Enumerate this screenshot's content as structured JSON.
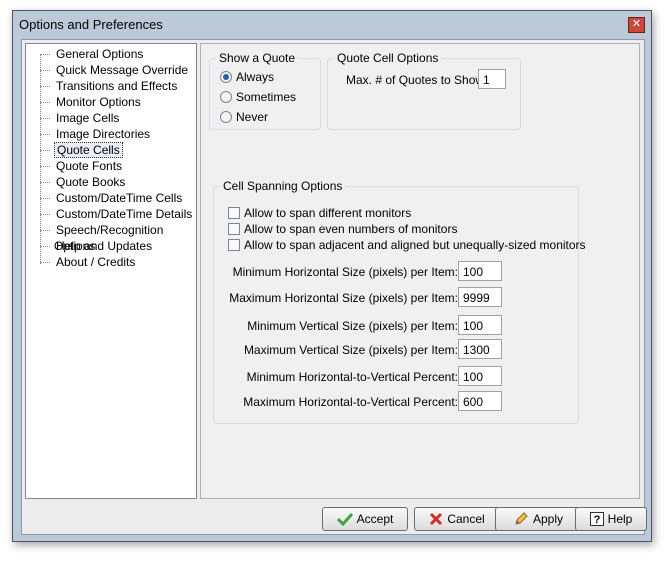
{
  "window": {
    "title": "Options and Preferences",
    "close_glyph": "✕"
  },
  "tree": {
    "items": [
      "General Options",
      "Quick Message Override",
      "Transitions and Effects",
      "Monitor Options",
      "Image Cells",
      "Image Directories",
      "Quote Cells",
      "Quote Fonts",
      "Quote Books",
      "Custom/DateTime Cells",
      "Custom/DateTime Details",
      "Speech/Recognition Options",
      "Help and Updates",
      "About / Credits"
    ],
    "selected": "Quote Cells"
  },
  "show_quote": {
    "title": "Show a Quote",
    "options": [
      "Always",
      "Sometimes",
      "Never"
    ],
    "selected": "Always"
  },
  "quote_cell": {
    "title": "Quote Cell Options",
    "max_label": "Max. # of Quotes to Show:",
    "max_value": "1"
  },
  "spanning": {
    "title": "Cell Spanning Options",
    "checks": [
      "Allow to span different monitors",
      "Allow to span even numbers of monitors",
      "Allow to span adjacent and aligned but unequally-sized monitors"
    ],
    "fields": [
      {
        "label": "Minimum Horizontal Size (pixels) per Item:",
        "value": "100"
      },
      {
        "label": "Maximum Horizontal Size (pixels) per Item:",
        "value": "9999"
      },
      {
        "label": "Minimum Vertical Size (pixels) per Item:",
        "value": "100"
      },
      {
        "label": "Maximum Vertical Size (pixels) per Item:",
        "value": "1300"
      },
      {
        "label": "Minimum Horizontal-to-Vertical  Percent:",
        "value": "100"
      },
      {
        "label": "Maximum Horizontal-to-Vertical  Percent:",
        "value": "600"
      }
    ]
  },
  "buttons": {
    "accept": "Accept",
    "cancel": "Cancel",
    "apply": "Apply",
    "help": "Help"
  },
  "icons": {
    "accept": "check-mark-icon",
    "cancel": "x-icon",
    "apply": "pencil-icon",
    "help": "question-mark-icon"
  },
  "colors": {
    "frame": "#bcc9d8",
    "dialog": "#ececec",
    "close": "#c9483c",
    "accept_icon": "#3ea33e",
    "cancel_icon": "#d22b2b",
    "radio_dot": "#2c5fa8"
  }
}
